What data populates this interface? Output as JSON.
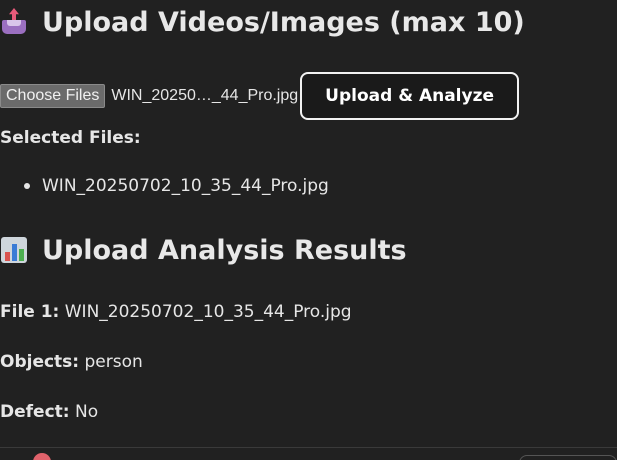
{
  "upload_section": {
    "title": "Upload Videos/Images (max 10)",
    "icon": "inbox-upload-icon",
    "choose_files_label": "Choose Files",
    "selected_file_display": "WIN_20250…_44_Pro.jpg",
    "analyze_button_label": "Upload & Analyze"
  },
  "selected_files": {
    "label": "Selected Files:",
    "items": [
      "WIN_20250702_10_35_44_Pro.jpg"
    ]
  },
  "results_section": {
    "title": "Upload Analysis Results",
    "icon": "bar-chart-icon",
    "results": [
      {
        "key": "File 1:",
        "value": "WIN_20250702_10_35_44_Pro.jpg"
      },
      {
        "key": "Objects:",
        "value": "person"
      },
      {
        "key": "Defect:",
        "value": "No"
      }
    ]
  },
  "colors": {
    "background": "#212121",
    "text": "#e6e6e6",
    "button_border": "#f2f2f2"
  }
}
